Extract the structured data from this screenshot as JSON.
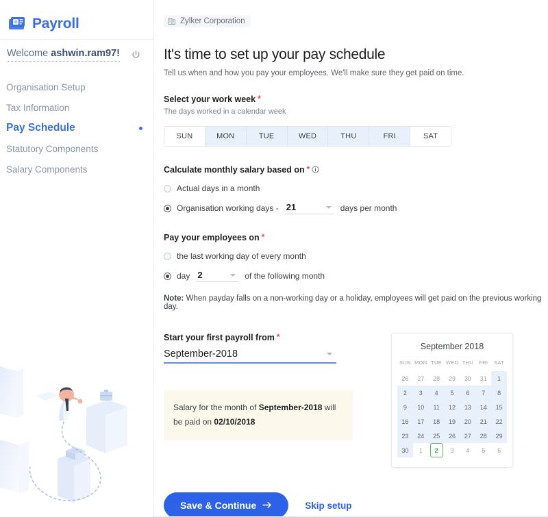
{
  "brand": {
    "name": "Payroll",
    "logo_icon": "payroll-logo-icon"
  },
  "sidebar": {
    "welcome_prefix": "Welcome ",
    "welcome_user": "ashwin.ram97!",
    "power_icon": "power-icon",
    "items": [
      {
        "label": "Organisation Setup",
        "active": false
      },
      {
        "label": "Tax Information",
        "active": false
      },
      {
        "label": "Pay Schedule",
        "active": true
      },
      {
        "label": "Statutory Components",
        "active": false
      },
      {
        "label": "Salary Components",
        "active": false
      }
    ]
  },
  "header": {
    "org_icon": "building-icon",
    "org_name": "Zylker Corporation",
    "title": "It's time to set up your pay schedule",
    "subtitle": "Tell us when and how you pay your employees. We'll make sure they get paid on time."
  },
  "work_week": {
    "label": "Select your work week",
    "required_mark": "*",
    "hint": "The days worked in a calendar week",
    "days": [
      {
        "label": "SUN",
        "selected": false
      },
      {
        "label": "MON",
        "selected": true
      },
      {
        "label": "TUE",
        "selected": true
      },
      {
        "label": "WED",
        "selected": true
      },
      {
        "label": "THU",
        "selected": true
      },
      {
        "label": "FRI",
        "selected": true
      },
      {
        "label": "SAT",
        "selected": false
      }
    ]
  },
  "calculate_salary": {
    "label": "Calculate monthly salary based on",
    "required_mark": "*",
    "info_icon": "info-icon",
    "option_actual": "Actual days in a month",
    "option_org_prefix": "Organisation working days -",
    "org_days_value": "21",
    "option_org_suffix": "days per month",
    "selected": "organisation_working_days"
  },
  "pay_on": {
    "label": "Pay your employees on",
    "required_mark": "*",
    "option_last": "the last working day of every month",
    "option_day_prefix": "day",
    "day_value": "2",
    "option_day_suffix": "of the following month",
    "selected": "day_of_following_month",
    "note_label": "Note:",
    "note_text": " When payday falls on a non-working day or a holiday, employees will get paid on the previous working day."
  },
  "payroll_start": {
    "label": "Start your first payroll from",
    "required_mark": "*",
    "value": "September-2018"
  },
  "salary_notice": {
    "prefix": "Salary for the month of ",
    "month": "September-2018",
    "middle": " will be paid on ",
    "date": "02/10/2018"
  },
  "calendar": {
    "title": "September 2018",
    "dow": [
      "SUN",
      "MON",
      "TUE",
      "WED",
      "THU",
      "FRI",
      "SAT"
    ],
    "weeks": [
      [
        {
          "d": "26",
          "muted": true,
          "hl": false,
          "today": false
        },
        {
          "d": "27",
          "muted": true,
          "hl": false,
          "today": false
        },
        {
          "d": "28",
          "muted": true,
          "hl": false,
          "today": false
        },
        {
          "d": "29",
          "muted": true,
          "hl": false,
          "today": false
        },
        {
          "d": "30",
          "muted": true,
          "hl": false,
          "today": false
        },
        {
          "d": "31",
          "muted": true,
          "hl": false,
          "today": false
        },
        {
          "d": "1",
          "muted": false,
          "hl": true,
          "today": false
        }
      ],
      [
        {
          "d": "2",
          "muted": false,
          "hl": true,
          "today": false
        },
        {
          "d": "3",
          "muted": false,
          "hl": true,
          "today": false
        },
        {
          "d": "4",
          "muted": false,
          "hl": true,
          "today": false
        },
        {
          "d": "5",
          "muted": false,
          "hl": true,
          "today": false
        },
        {
          "d": "6",
          "muted": false,
          "hl": true,
          "today": false
        },
        {
          "d": "7",
          "muted": false,
          "hl": true,
          "today": false
        },
        {
          "d": "8",
          "muted": false,
          "hl": true,
          "today": false
        }
      ],
      [
        {
          "d": "9",
          "muted": false,
          "hl": true,
          "today": false
        },
        {
          "d": "10",
          "muted": false,
          "hl": true,
          "today": false
        },
        {
          "d": "11",
          "muted": false,
          "hl": true,
          "today": false
        },
        {
          "d": "12",
          "muted": false,
          "hl": true,
          "today": false
        },
        {
          "d": "13",
          "muted": false,
          "hl": true,
          "today": false
        },
        {
          "d": "14",
          "muted": false,
          "hl": true,
          "today": false
        },
        {
          "d": "15",
          "muted": false,
          "hl": true,
          "today": false
        }
      ],
      [
        {
          "d": "16",
          "muted": false,
          "hl": true,
          "today": false
        },
        {
          "d": "17",
          "muted": false,
          "hl": true,
          "today": false
        },
        {
          "d": "18",
          "muted": false,
          "hl": true,
          "today": false
        },
        {
          "d": "19",
          "muted": false,
          "hl": true,
          "today": false
        },
        {
          "d": "20",
          "muted": false,
          "hl": true,
          "today": false
        },
        {
          "d": "21",
          "muted": false,
          "hl": true,
          "today": false
        },
        {
          "d": "22",
          "muted": false,
          "hl": true,
          "today": false
        }
      ],
      [
        {
          "d": "23",
          "muted": false,
          "hl": true,
          "today": false
        },
        {
          "d": "24",
          "muted": false,
          "hl": true,
          "today": false
        },
        {
          "d": "25",
          "muted": false,
          "hl": true,
          "today": false
        },
        {
          "d": "26",
          "muted": false,
          "hl": true,
          "today": false
        },
        {
          "d": "27",
          "muted": false,
          "hl": true,
          "today": false
        },
        {
          "d": "28",
          "muted": false,
          "hl": true,
          "today": false
        },
        {
          "d": "29",
          "muted": false,
          "hl": true,
          "today": false
        }
      ],
      [
        {
          "d": "30",
          "muted": false,
          "hl": true,
          "today": false
        },
        {
          "d": "1",
          "muted": true,
          "hl": false,
          "today": false
        },
        {
          "d": "2",
          "muted": false,
          "hl": false,
          "today": true
        },
        {
          "d": "3",
          "muted": true,
          "hl": false,
          "today": false
        },
        {
          "d": "4",
          "muted": true,
          "hl": false,
          "today": false
        },
        {
          "d": "5",
          "muted": true,
          "hl": false,
          "today": false
        },
        {
          "d": "6",
          "muted": true,
          "hl": false,
          "today": false
        }
      ]
    ]
  },
  "actions": {
    "primary_label": "Save & Continue",
    "primary_icon": "arrow-right-icon",
    "skip_label": "Skip setup"
  },
  "colors": {
    "accent": "#2d62e8",
    "brand": "#3b6fe0",
    "selected_day_bg": "#e8f0fc",
    "notice_bg": "#fdf8ec",
    "today_green": "#5cb85c",
    "required_red": "#f04a4a"
  }
}
